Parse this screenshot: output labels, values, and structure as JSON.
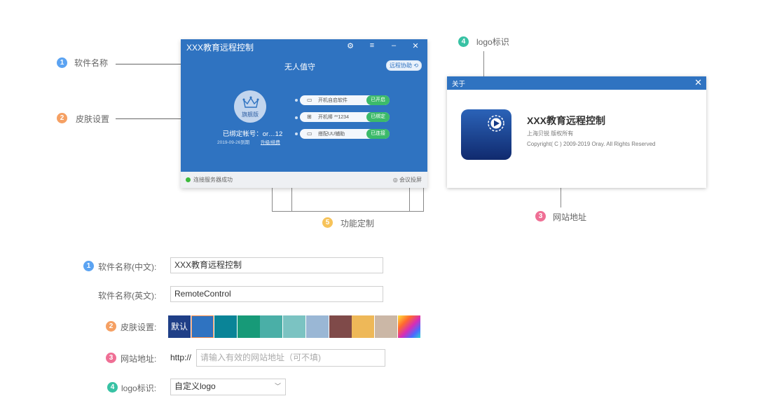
{
  "callouts": {
    "software_name": {
      "num": "1",
      "label": "软件名称"
    },
    "skin": {
      "num": "2",
      "label": "皮肤设置"
    },
    "website": {
      "num": "3",
      "label": "网站地址"
    },
    "logo": {
      "num": "4",
      "label": "logo标识"
    },
    "features": {
      "num": "5",
      "label": "功能定制"
    }
  },
  "remote_window": {
    "title": "XXX教育远程控制",
    "status_title": "无人值守",
    "remote_assist": "远程协助 ⟲",
    "avatar_label": "旗舰版",
    "account": "已绑定帐号：or…12",
    "expire_date": "2019-09-26到期",
    "upgrade_link": "升级/续费",
    "features": [
      {
        "label": "开机自启软件",
        "badge": "已开启",
        "icon": "monitor-icon"
      },
      {
        "label": "开机棒 **1234",
        "badge": "已绑定",
        "icon": "power-stick-icon"
      },
      {
        "label": "搭配UU辅助",
        "badge": "已连接",
        "icon": "uu-icon"
      }
    ],
    "footer_status": "连接服务器成功",
    "footer_meeting": "会议投屏"
  },
  "about_dialog": {
    "title": "关于",
    "app_name": "XXX教育远程控制",
    "company": "上海贝锐 版权所有",
    "copyright": "Copyright( C ) 2009-2019 Oray. All Rights Reserved"
  },
  "form": {
    "name_cn": {
      "num": "1",
      "label": "软件名称(中文):",
      "value": "XXX教育远程控制"
    },
    "name_en": {
      "label": "软件名称(英文):",
      "value": "RemoteControl"
    },
    "skin": {
      "num": "2",
      "label": "皮肤设置:",
      "default_label": "默认",
      "colors": [
        "#1f3f87",
        "#2f73c1",
        "#0a8497",
        "#179a78",
        "#4aafa7",
        "#7bc3c2",
        "#9ab7d5",
        "#7f4a49",
        "#eeb858",
        "#cbb7a6"
      ]
    },
    "website": {
      "num": "3",
      "label": "网站地址:",
      "prefix": "http://",
      "placeholder": "请输入有效的网站地址（可不填)"
    },
    "logo": {
      "num": "4",
      "label": "logo标识:",
      "selected": "自定义logo"
    }
  }
}
